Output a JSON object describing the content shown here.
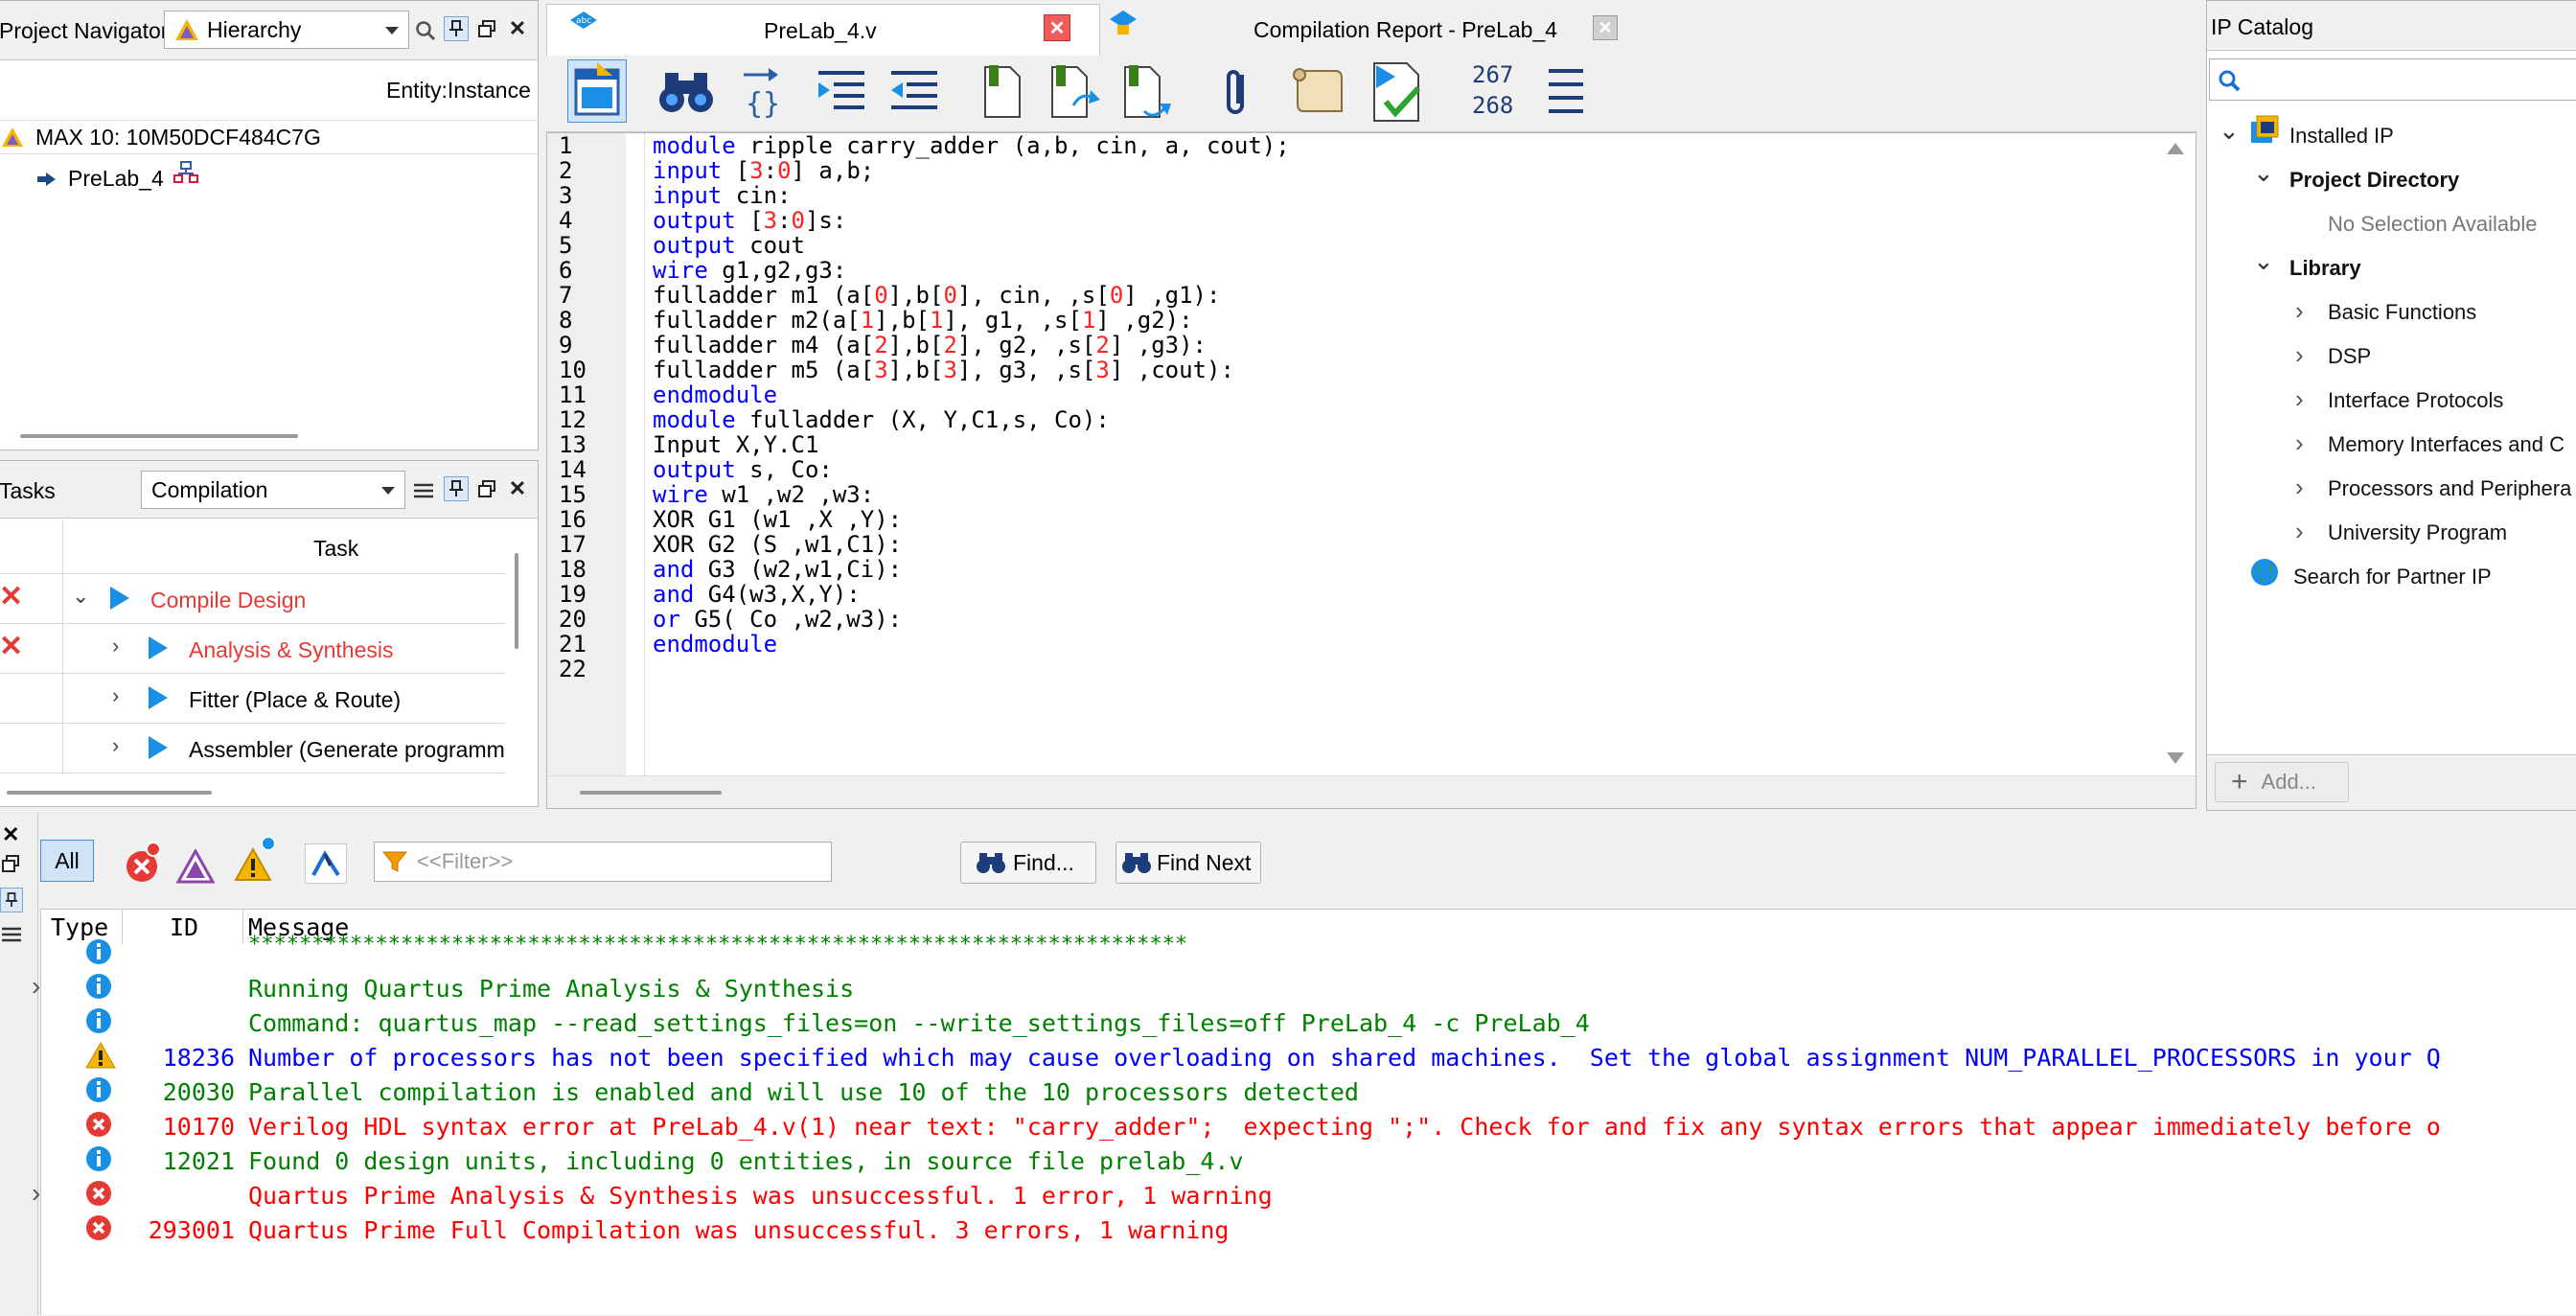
{
  "project_navigator": {
    "title": "Project Navigator",
    "view": "Hierarchy",
    "column_header": "Entity:Instance",
    "device": "MAX 10: 10M50DCF484C7G",
    "top_entity": "PreLab_4"
  },
  "tasks": {
    "title": "Tasks",
    "flow": "Compilation",
    "column_header": "Task",
    "rows": [
      {
        "label": "Compile Design",
        "status": "error"
      },
      {
        "label": "Analysis & Synthesis",
        "status": "error"
      },
      {
        "label": "Fitter (Place & Route)",
        "status": "none"
      },
      {
        "label": "Assembler (Generate programm",
        "status": "none"
      }
    ]
  },
  "editor": {
    "tabs": [
      {
        "label": "PreLab_4.v",
        "active": true
      },
      {
        "label": "Compilation Report - PreLab_4",
        "active": false
      }
    ],
    "toolbar": {
      "line_a": "267",
      "line_b": "268"
    },
    "line_numbers": [
      "1",
      "2",
      "3",
      "4",
      "5",
      "6",
      "7",
      "8",
      "9",
      "10",
      "11",
      "12",
      "13",
      "14",
      "15",
      "16",
      "17",
      "18",
      "19",
      "20",
      "21",
      "22"
    ]
  },
  "ip_catalog": {
    "title": "IP Catalog",
    "search_placeholder": "",
    "installed_ip": "Installed IP",
    "project_directory": "Project Directory",
    "no_selection": "No Selection Available",
    "library": "Library",
    "library_items": [
      "Basic Functions",
      "DSP",
      "Interface Protocols",
      "Memory Interfaces and C",
      "Processors and Periphera",
      "University Program"
    ],
    "partner": "Search for Partner IP",
    "add_button": "Add..."
  },
  "messages": {
    "all_label": "All",
    "filter_placeholder": "<<Filter>>",
    "find_label": "Find...",
    "find_next_label": "Find Next",
    "col_type": "Type",
    "col_id": "ID",
    "col_message": "Message",
    "rows": [
      {
        "type": "info",
        "id": "",
        "text": "**************************************************************************",
        "color": "#008000",
        "expand": false
      },
      {
        "type": "info",
        "id": "",
        "text": "Running Quartus Prime Analysis & Synthesis",
        "color": "#008000",
        "expand": true
      },
      {
        "type": "info",
        "id": "",
        "text": "Command: quartus_map --read_settings_files=on --write_settings_files=off PreLab_4 -c PreLab_4",
        "color": "#008000",
        "expand": false
      },
      {
        "type": "warn",
        "id": "18236",
        "text": "Number of processors has not been specified which may cause overloading on shared machines.  Set the global assignment NUM_PARALLEL_PROCESSORS in your Q",
        "color": "#0000ff",
        "expand": false
      },
      {
        "type": "info",
        "id": "20030",
        "text": "Parallel compilation is enabled and will use 10 of the 10 processors detected",
        "color": "#008000",
        "expand": false
      },
      {
        "type": "error",
        "id": "10170",
        "text": "Verilog HDL syntax error at PreLab_4.v(1) near text: \"carry_adder\";  expecting \";\". Check for and fix any syntax errors that appear immediately before o",
        "color": "#ff0000",
        "expand": false
      },
      {
        "type": "info",
        "id": "12021",
        "text": "Found 0 design units, including 0 entities, in source file prelab_4.v",
        "color": "#008000",
        "expand": false
      },
      {
        "type": "error",
        "id": "",
        "text": "Quartus Prime Analysis & Synthesis was unsuccessful. 1 error, 1 warning",
        "color": "#ff0000",
        "expand": true
      },
      {
        "type": "error",
        "id": "293001",
        "text": "Quartus Prime Full Compilation was unsuccessful. 3 errors, 1 warning",
        "color": "#ff0000",
        "expand": false
      }
    ]
  },
  "colors": {
    "error": "#e53935",
    "info": "#1a8fe6",
    "warning": "#f5b400",
    "keyword": "#0000ff",
    "number": "#ff2020",
    "green": "#008000"
  }
}
